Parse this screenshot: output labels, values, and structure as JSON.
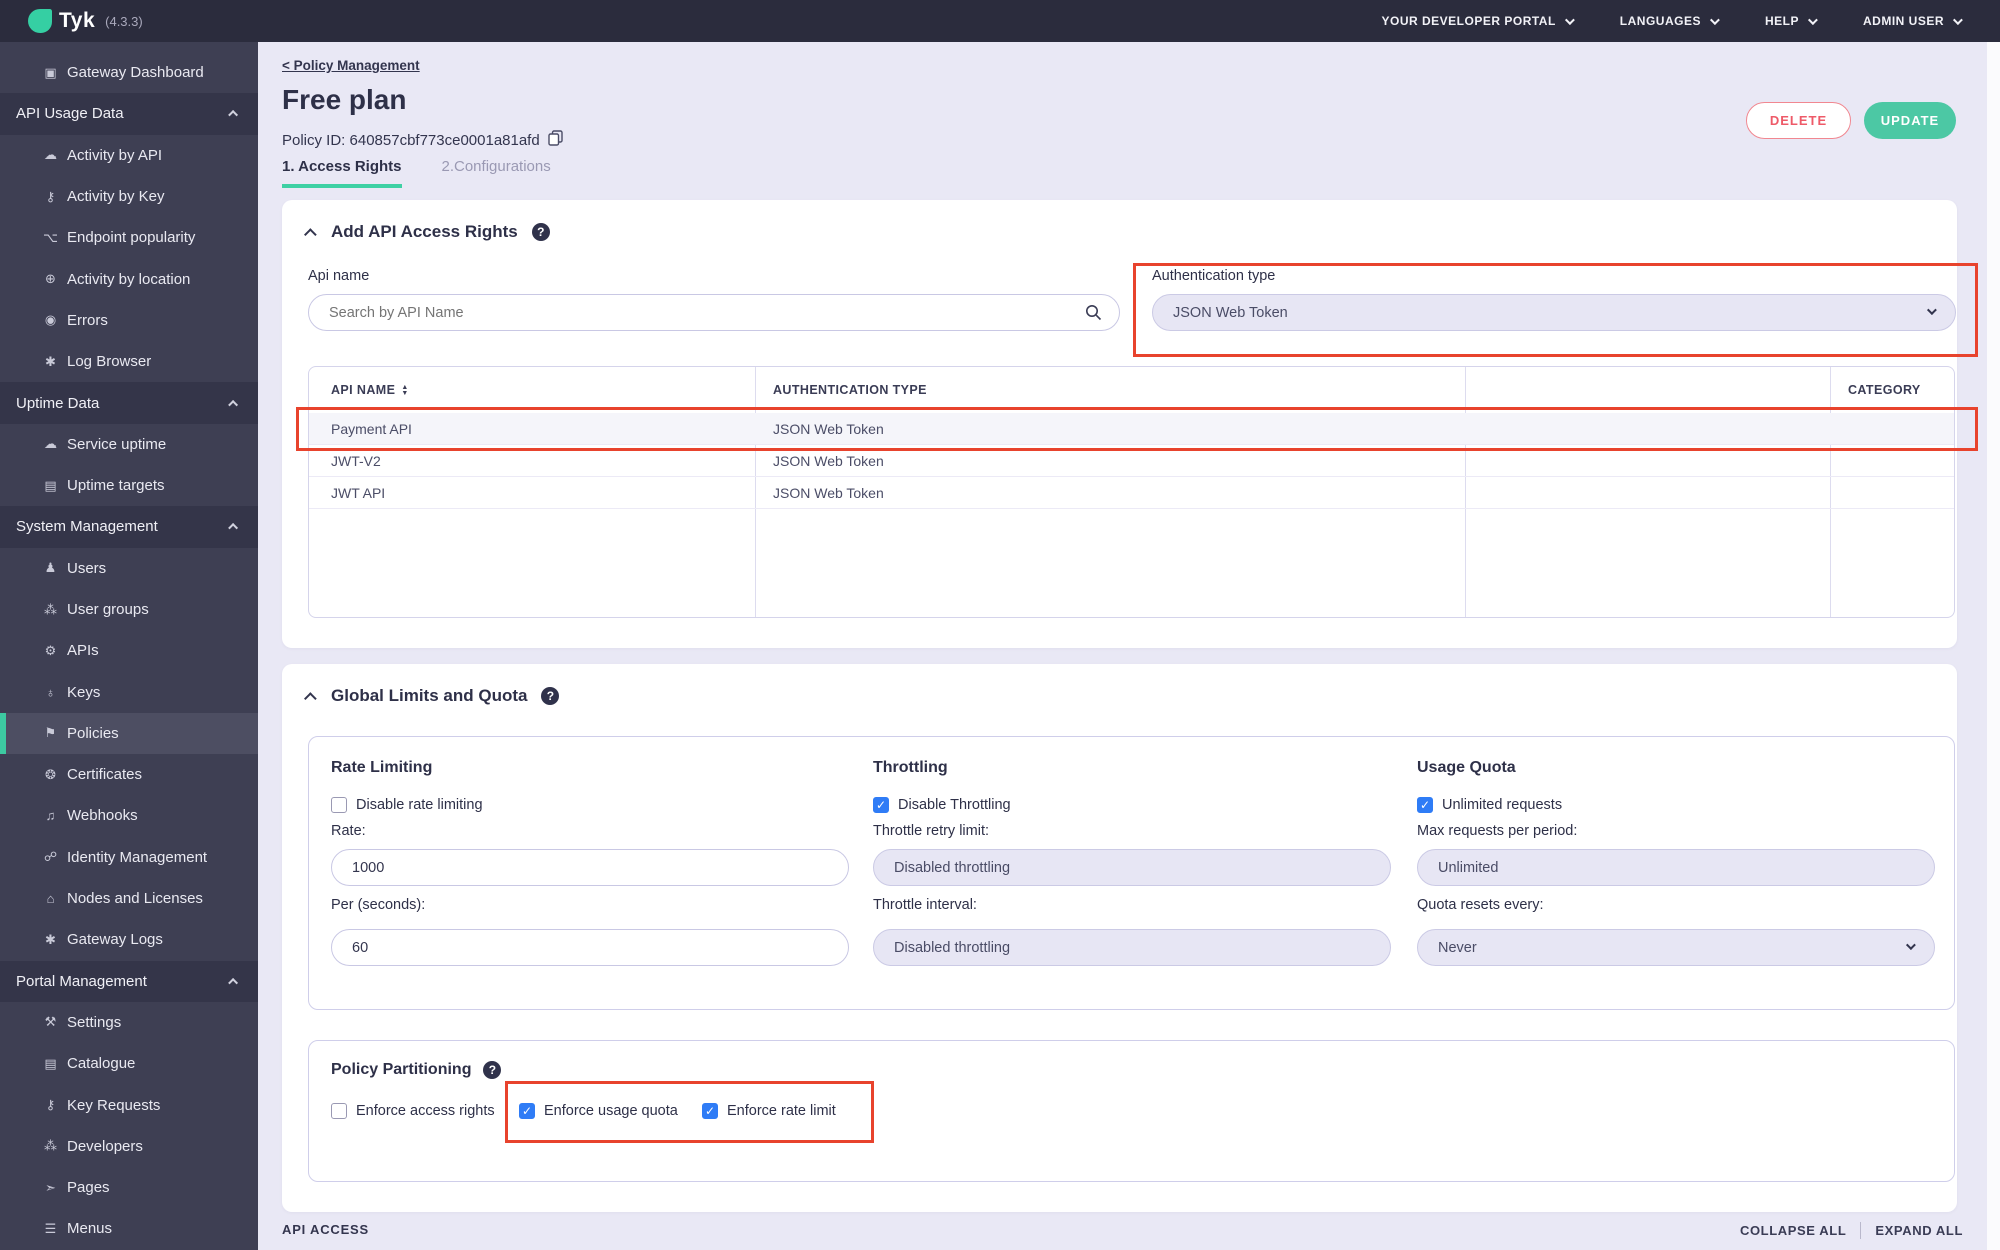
{
  "header": {
    "logo_text": "Tyk",
    "version": "(4.3.3)",
    "nav": [
      "YOUR DEVELOPER PORTAL",
      "LANGUAGES",
      "HELP",
      "ADMIN USER"
    ]
  },
  "sidebar": {
    "items": [
      {
        "type": "item",
        "label": "Gateway Dashboard",
        "icon": "▣"
      },
      {
        "type": "section",
        "label": "API Usage Data"
      },
      {
        "type": "item",
        "label": "Activity by API",
        "icon": "☁"
      },
      {
        "type": "item",
        "label": "Activity by Key",
        "icon": "⚷"
      },
      {
        "type": "item",
        "label": "Endpoint popularity",
        "icon": "⌥"
      },
      {
        "type": "item",
        "label": "Activity by location",
        "icon": "⊕"
      },
      {
        "type": "item",
        "label": "Errors",
        "icon": "◉"
      },
      {
        "type": "item",
        "label": "Log Browser",
        "icon": "✱"
      },
      {
        "type": "section",
        "label": "Uptime Data"
      },
      {
        "type": "item",
        "label": "Service uptime",
        "icon": "☁"
      },
      {
        "type": "item",
        "label": "Uptime targets",
        "icon": "▤"
      },
      {
        "type": "section",
        "label": "System Management"
      },
      {
        "type": "item",
        "label": "Users",
        "icon": "♟"
      },
      {
        "type": "item",
        "label": "User groups",
        "icon": "⁂"
      },
      {
        "type": "item",
        "label": "APIs",
        "icon": "⚙"
      },
      {
        "type": "item",
        "label": "Keys",
        "icon": "♁"
      },
      {
        "type": "item",
        "label": "Policies",
        "icon": "⚑",
        "active": true
      },
      {
        "type": "item",
        "label": "Certificates",
        "icon": "❂"
      },
      {
        "type": "item",
        "label": "Webhooks",
        "icon": "♫"
      },
      {
        "type": "item",
        "label": "Identity Management",
        "icon": "☍"
      },
      {
        "type": "item",
        "label": "Nodes and Licenses",
        "icon": "⌂"
      },
      {
        "type": "item",
        "label": "Gateway Logs",
        "icon": "✱"
      },
      {
        "type": "section",
        "label": "Portal Management"
      },
      {
        "type": "item",
        "label": "Settings",
        "icon": "⚒"
      },
      {
        "type": "item",
        "label": "Catalogue",
        "icon": "▤"
      },
      {
        "type": "item",
        "label": "Key Requests",
        "icon": "⚷"
      },
      {
        "type": "item",
        "label": "Developers",
        "icon": "⁂"
      },
      {
        "type": "item",
        "label": "Pages",
        "icon": "➣"
      },
      {
        "type": "item",
        "label": "Menus",
        "icon": "☰"
      }
    ]
  },
  "page": {
    "breadcrumb": "< Policy Management",
    "title": "Free plan",
    "policy_id": "Policy ID: 640857cbf773ce0001a81afd",
    "tabs": {
      "access_rights": "1. Access Rights",
      "configurations": "2.Configurations"
    },
    "delete_label": "DELETE",
    "update_label": "UPDATE"
  },
  "access_rights": {
    "title": "Add API Access Rights",
    "api_name_label": "Api name",
    "search_placeholder": "Search by API Name",
    "auth_type_label": "Authentication type",
    "auth_type_value": "JSON Web Token",
    "table": {
      "columns": [
        "API NAME",
        "AUTHENTICATION TYPE",
        "CATEGORY"
      ],
      "rows": [
        {
          "api_name": "Payment API",
          "auth_type": "JSON Web Token",
          "category": "",
          "highlighted": true
        },
        {
          "api_name": "JWT-V2",
          "auth_type": "JSON Web Token",
          "category": "",
          "highlighted": false
        },
        {
          "api_name": "JWT API",
          "auth_type": "JSON Web Token",
          "category": "",
          "highlighted": false
        }
      ]
    }
  },
  "global_limits": {
    "title": "Global Limits and Quota",
    "rate_limiting": {
      "title": "Rate Limiting",
      "checkbox_label": "Disable rate limiting",
      "checked": false,
      "field1_label": "Rate:",
      "field1_value": "1000",
      "field2_label": "Per (seconds):",
      "field2_value": "60"
    },
    "throttling": {
      "title": "Throttling",
      "checkbox_label": "Disable Throttling",
      "checked": true,
      "field1_label": "Throttle retry limit:",
      "field1_value": "Disabled throttling",
      "field2_label": "Throttle interval:",
      "field2_value": "Disabled throttling"
    },
    "usage_quota": {
      "title": "Usage Quota",
      "checkbox_label": "Unlimited requests",
      "checked": true,
      "field1_label": "Max requests per period:",
      "field1_value": "Unlimited",
      "field2_label": "Quota resets every:",
      "field2_value": "Never"
    }
  },
  "policy_partitioning": {
    "title": "Policy Partitioning",
    "checkboxes": [
      {
        "label": "Enforce access rights",
        "checked": false
      },
      {
        "label": "Enforce usage quota",
        "checked": true
      },
      {
        "label": "Enforce rate limit",
        "checked": true
      }
    ]
  },
  "footer": {
    "section_label": "API ACCESS",
    "collapse_all": "COLLAPSE ALL",
    "expand_all": "EXPAND ALL"
  },
  "colors": {
    "accent_teal": "#3ed0a4",
    "annotation_red": "#e8432d",
    "delete_red": "#ee5a68",
    "checkbox_blue": "#2f7cf6",
    "sidebar_bg": "#3e3f53",
    "header_bg": "#2b2c3d",
    "page_bg": "#e9e8f5"
  }
}
